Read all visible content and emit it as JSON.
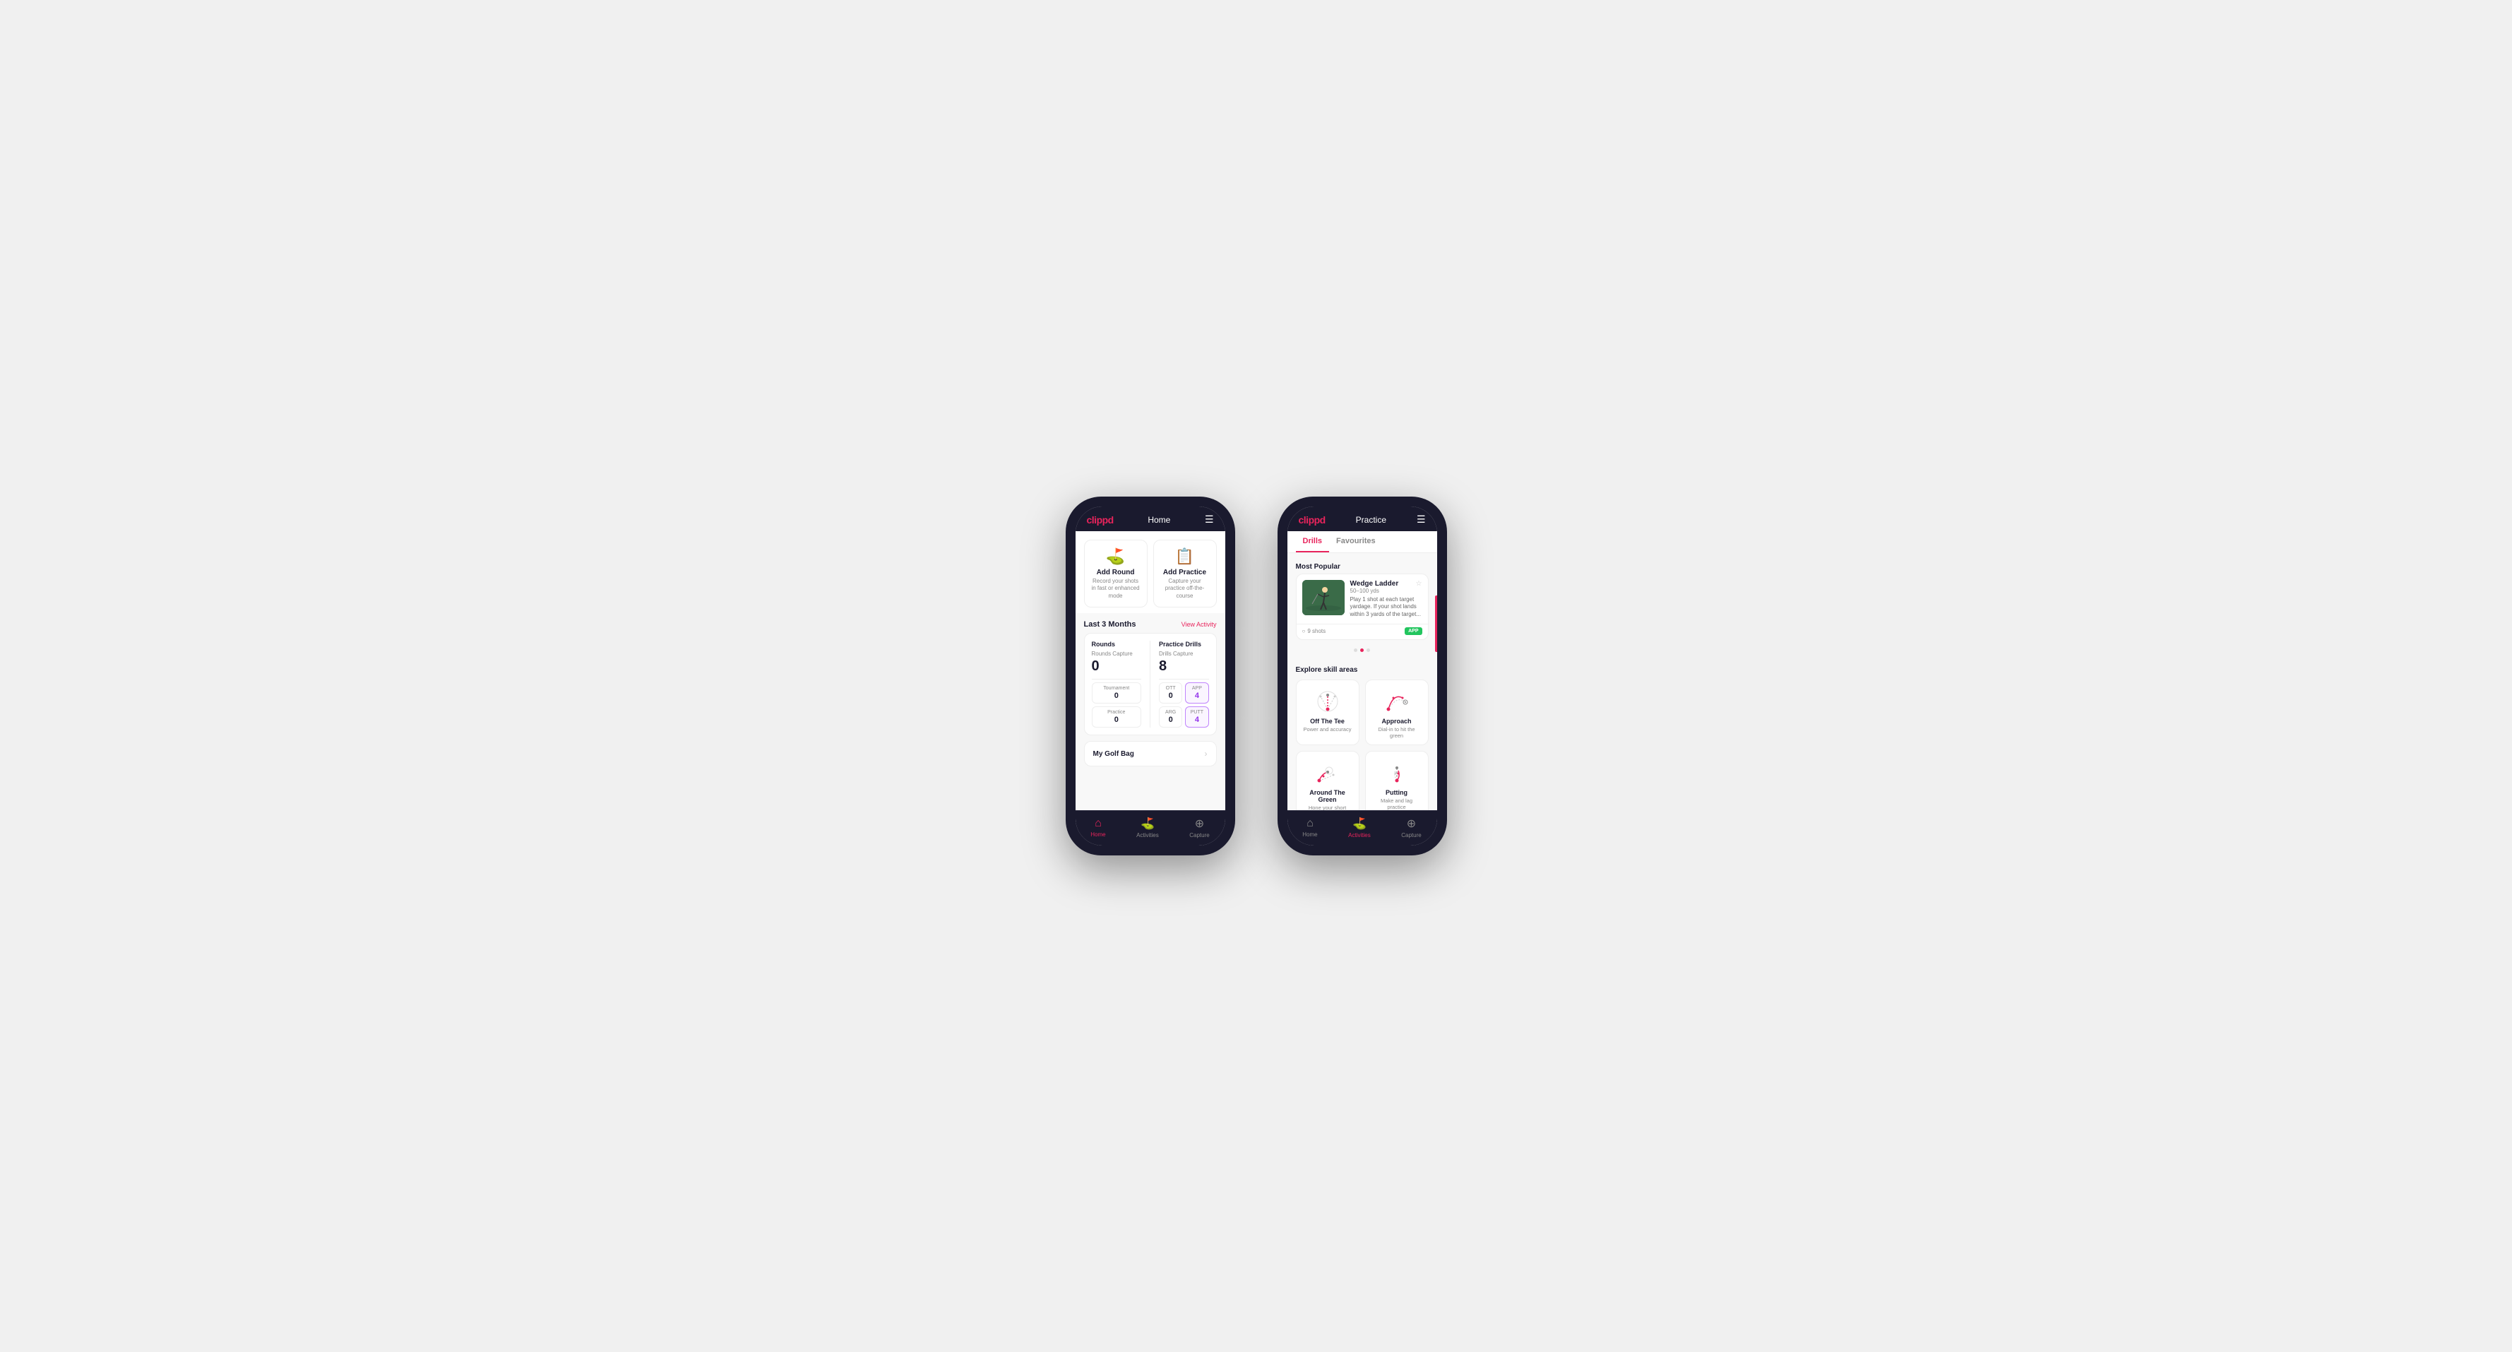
{
  "phone1": {
    "topBar": {
      "logo": "clippd",
      "title": "Home",
      "menuIcon": "☰"
    },
    "quickActions": [
      {
        "id": "add-round",
        "icon": "⛳",
        "title": "Add Round",
        "desc": "Record your shots in fast or enhanced mode"
      },
      {
        "id": "add-practice",
        "icon": "📋",
        "title": "Add Practice",
        "desc": "Capture your practice off-the-course"
      }
    ],
    "activity": {
      "sectionTitle": "Last 3 Months",
      "viewLink": "View Activity",
      "rounds": {
        "title": "Rounds",
        "captureLabel": "Rounds Capture",
        "total": "0",
        "tournamentLabel": "Tournament",
        "tournamentVal": "0",
        "practiceLabel": "Practice",
        "practiceVal": "0"
      },
      "drills": {
        "title": "Practice Drills",
        "captureLabel": "Drills Capture",
        "total": "8",
        "ottLabel": "OTT",
        "ottVal": "0",
        "appLabel": "APP",
        "appVal": "4",
        "argLabel": "ARG",
        "argVal": "0",
        "puttLabel": "PUTT",
        "puttVal": "4"
      }
    },
    "golfBag": "My Golf Bag",
    "bottomNav": [
      {
        "icon": "🏠",
        "label": "Home",
        "active": true
      },
      {
        "icon": "⛳",
        "label": "Activities",
        "active": false
      },
      {
        "icon": "➕",
        "label": "Capture",
        "active": false
      }
    ]
  },
  "phone2": {
    "topBar": {
      "logo": "clippd",
      "title": "Practice",
      "menuIcon": "☰"
    },
    "tabs": [
      {
        "label": "Drills",
        "active": true
      },
      {
        "label": "Favourites",
        "active": false
      }
    ],
    "mostPopular": {
      "title": "Most Popular",
      "drill": {
        "title": "Wedge Ladder",
        "yardage": "50–100 yds",
        "desc": "Play 1 shot at each target yardage. If your shot lands within 3 yards of the target...",
        "shots": "9 shots",
        "badge": "APP"
      }
    },
    "dots": [
      false,
      true,
      false
    ],
    "skillAreas": {
      "title": "Explore skill areas",
      "items": [
        {
          "name": "Off The Tee",
          "desc": "Power and accuracy",
          "iconType": "tee"
        },
        {
          "name": "Approach",
          "desc": "Dial-in to hit the green",
          "iconType": "approach"
        },
        {
          "name": "Around The Green",
          "desc": "Hone your short game",
          "iconType": "atg"
        },
        {
          "name": "Putting",
          "desc": "Make and lag practice",
          "iconType": "putt"
        }
      ]
    },
    "bottomNav": [
      {
        "icon": "🏠",
        "label": "Home",
        "active": false
      },
      {
        "icon": "⛳",
        "label": "Activities",
        "active": true
      },
      {
        "icon": "➕",
        "label": "Capture",
        "active": false
      }
    ]
  }
}
